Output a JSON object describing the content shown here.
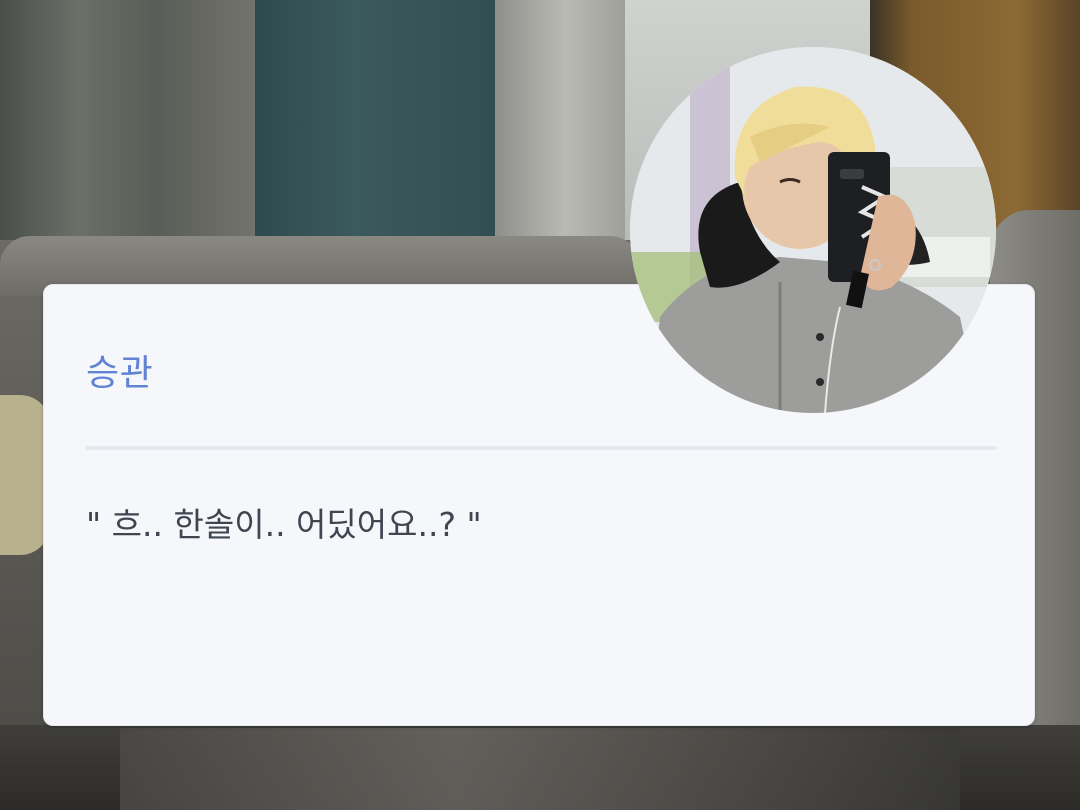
{
  "dialog": {
    "speaker": "승관",
    "line": "\" 흐.. 한솔이.. 어딨어요..? \""
  },
  "avatar": {
    "icon": "character-portrait"
  },
  "colors": {
    "speaker_name": "#6283d3",
    "dialog_text": "#3f4651",
    "dialog_background": "#f5f7fa",
    "divider": "#e4e9ef"
  }
}
